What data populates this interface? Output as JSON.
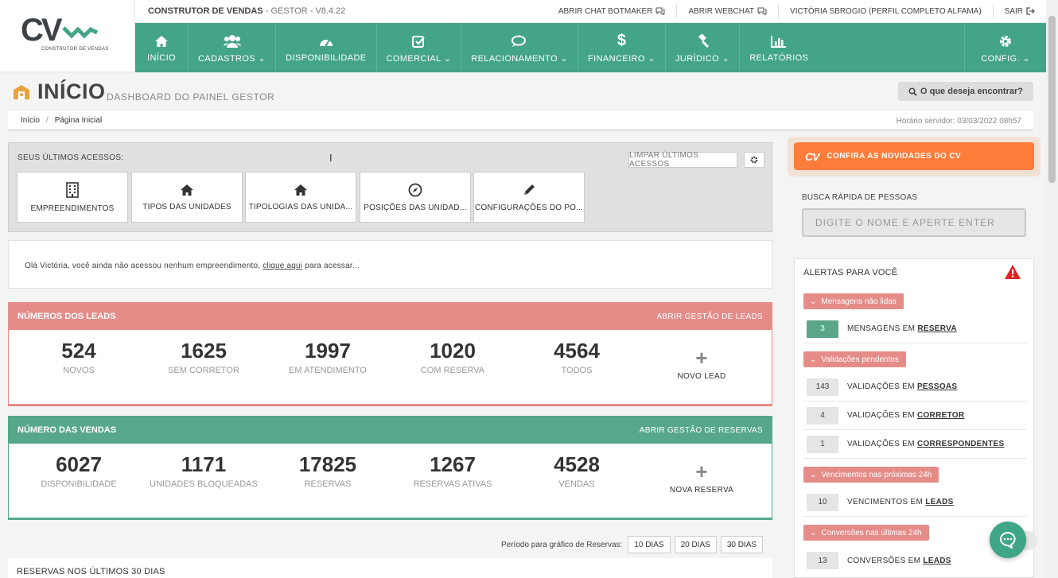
{
  "logo": {
    "mark": "CV",
    "subtitle": "CONSTRUTOR DE VENDAS"
  },
  "topbar": {
    "app": "CONSTRUTOR DE VENDAS",
    "version": "- GESTOR - V8.4.22",
    "links": [
      {
        "label": "ABRIR CHAT BOTMAKER",
        "icon": "chat-bubbles-icon"
      },
      {
        "label": "ABRIR WEBCHAT",
        "icon": "chat-bubbles-icon"
      },
      {
        "label": "VICTÓRIA SBROGIO (PERFIL COMPLETO ALFAMA)",
        "icon": ""
      },
      {
        "label": "SAIR",
        "icon": "sign-out-icon"
      }
    ]
  },
  "nav": {
    "items": [
      {
        "label": "INÍCIO",
        "icon": "home-icon"
      },
      {
        "label": "CADASTROS",
        "icon": "users-icon",
        "caret": "⌄"
      },
      {
        "label": "DISPONIBILIDADE",
        "icon": "dashboard-icon"
      },
      {
        "label": "COMERCIAL",
        "icon": "check-square-icon",
        "caret": "⌄"
      },
      {
        "label": "RELACIONAMENTO",
        "icon": "comments-icon",
        "caret": "⌄"
      },
      {
        "label": "FINANCEIRO",
        "icon": "dollar-icon",
        "caret": "⌄"
      },
      {
        "label": "JURÍDICO",
        "icon": "gavel-icon",
        "caret": "⌄"
      },
      {
        "label": "RELATÓRIOS",
        "icon": "bar-chart-icon"
      }
    ],
    "config": {
      "label": "CONFIG.",
      "icon": "gear-icon",
      "caret": "⌄"
    }
  },
  "page": {
    "title": "INÍCIO",
    "subtitle": "DASHBOARD DO PAINEL GESTOR",
    "search_label": "O que deseja encontrar?",
    "breadcrumb": [
      "Início",
      "/",
      "Página Inicial"
    ],
    "server_time": "Horário servidor: 03/03/2022 08h57"
  },
  "recent": {
    "label": "SEUS ÚLTIMOS ACESSOS:",
    "clear": "LIMPAR ÚLTIMOS ACESSOS",
    "cards": [
      {
        "label": "EMPREENDIMENTOS",
        "icon": "building-icon"
      },
      {
        "label": "TIPOS DAS UNIDADES",
        "icon": "home-icon"
      },
      {
        "label": "TIPOLOGIAS DAS UNIDA...",
        "icon": "home-icon"
      },
      {
        "label": "POSIÇÕES DAS UNIDAD...",
        "icon": "compass-icon"
      },
      {
        "label": "CONFIGURAÇÕES DO PO...",
        "icon": "pencil-icon"
      }
    ]
  },
  "welcome": {
    "before": "Olá Victória, você ainda não acessou nenhum empreendimento,",
    "link": "clique aqui",
    "after": "para acessar..."
  },
  "leads": {
    "title": "NÚMEROS DOS LEADS",
    "action": "ABRIR GESTÃO DE LEADS",
    "color": "#e58c89",
    "stats": [
      {
        "value": "524",
        "label": "NOVOS"
      },
      {
        "value": "1625",
        "label": "SEM CORRETOR"
      },
      {
        "value": "1997",
        "label": "EM ATENDIMENTO"
      },
      {
        "value": "1020",
        "label": "COM RESERVA"
      },
      {
        "value": "4564",
        "label": "TODOS"
      }
    ],
    "add": {
      "plus": "+",
      "label": "NOVO LEAD"
    }
  },
  "sales": {
    "title": "NÚMERO DAS VENDAS",
    "action": "ABRIR GESTÃO DE RESERVAS",
    "color": "#57a88b",
    "stats": [
      {
        "value": "6027",
        "label": "DISPONIBILIDADE"
      },
      {
        "value": "1171",
        "label": "UNIDADES BLOQUEADAS"
      },
      {
        "value": "17825",
        "label": "RESERVAS"
      },
      {
        "value": "1267",
        "label": "RESERVAS ATIVAS"
      },
      {
        "value": "4528",
        "label": "VENDAS"
      }
    ],
    "add": {
      "plus": "+",
      "label": "NOVA RESERVA"
    }
  },
  "period": {
    "label": "Período para gráfico de Reservas:",
    "options": [
      "10 DIAS",
      "20 DIAS",
      "30 DIAS"
    ]
  },
  "reservations_title": "RESERVAS NOS ÚLTIMOS 30 DIAS",
  "news": {
    "mark": "CV",
    "label": "CONFIRA AS NOVIDADES DO CV"
  },
  "quick_search": {
    "label": "BUSCA RÁPIDA DE PESSOAS",
    "placeholder": "DIGITE O NOME E APERTE ENTER"
  },
  "alerts": {
    "title": "ALERTAS PARA VOCÊ",
    "groups": [
      {
        "tag": "Mensagens não lidas",
        "rows": [
          {
            "count": "3",
            "text": "MENSAGENS EM",
            "link": "RESERVA",
            "green": true
          }
        ]
      },
      {
        "tag": "Validações pendentes",
        "rows": [
          {
            "count": "143",
            "text": "VALIDAÇÕES EM",
            "link": "PESSOAS"
          },
          {
            "count": "4",
            "text": "VALIDAÇÕES EM",
            "link": "CORRETOR"
          },
          {
            "count": "1",
            "text": "VALIDAÇÕES EM",
            "link": "CORRESPONDENTES"
          }
        ]
      },
      {
        "tag": "Vencimentos nas próximas 24h",
        "rows": [
          {
            "count": "10",
            "text": "VENCIMENTOS EM",
            "link": "LEADS"
          }
        ]
      },
      {
        "tag": "Conversões nas últimas 24h",
        "rows": [
          {
            "count": "13",
            "text": "CONVERSÕES EM",
            "link": "LEADS"
          }
        ]
      }
    ]
  }
}
